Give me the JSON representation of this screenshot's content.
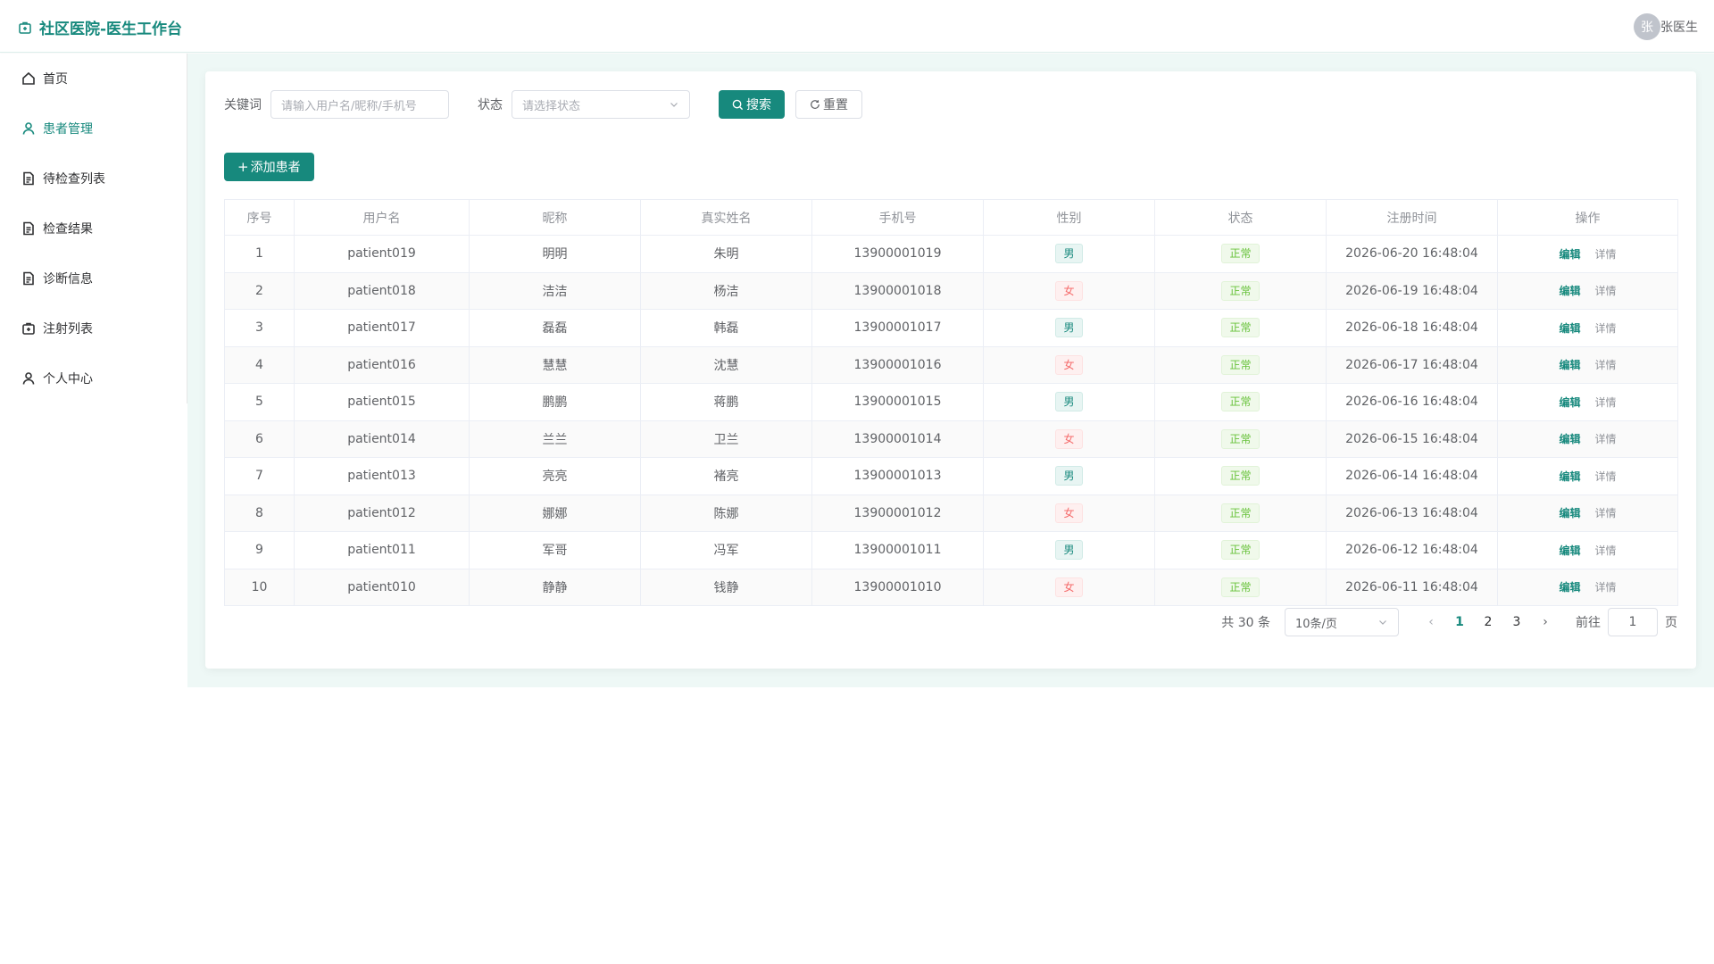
{
  "header": {
    "title": "社区医院-医生工作台",
    "avatar_text": "张",
    "user_name": "张医生"
  },
  "sidebar": {
    "items": [
      {
        "label": "首页",
        "icon": "home-icon"
      },
      {
        "label": "患者管理",
        "icon": "user-icon",
        "active": true
      },
      {
        "label": "待检查列表",
        "icon": "document-icon"
      },
      {
        "label": "检查结果",
        "icon": "document-icon"
      },
      {
        "label": "诊断信息",
        "icon": "document-icon"
      },
      {
        "label": "注射列表",
        "icon": "first-aid-icon"
      },
      {
        "label": "个人中心",
        "icon": "user-icon"
      }
    ]
  },
  "filter": {
    "keyword_label": "关键词",
    "keyword_placeholder": "请输入用户名/昵称/手机号",
    "status_label": "状态",
    "status_placeholder": "请选择状态",
    "search_label": "搜索",
    "reset_label": "重置"
  },
  "add_button_label": "添加患者",
  "table": {
    "columns": [
      "序号",
      "用户名",
      "昵称",
      "真实姓名",
      "手机号",
      "性别",
      "状态",
      "注册时间",
      "操作"
    ],
    "edit_label": "编辑",
    "detail_label": "详情",
    "rows": [
      {
        "no": "1",
        "username": "patient019",
        "nickname": "明明",
        "realname": "朱明",
        "phone": "13900001019",
        "gender": "男",
        "status": "正常",
        "time": "2026-06-20 16:48:04"
      },
      {
        "no": "2",
        "username": "patient018",
        "nickname": "洁洁",
        "realname": "杨洁",
        "phone": "13900001018",
        "gender": "女",
        "status": "正常",
        "time": "2026-06-19 16:48:04"
      },
      {
        "no": "3",
        "username": "patient017",
        "nickname": "磊磊",
        "realname": "韩磊",
        "phone": "13900001017",
        "gender": "男",
        "status": "正常",
        "time": "2026-06-18 16:48:04"
      },
      {
        "no": "4",
        "username": "patient016",
        "nickname": "慧慧",
        "realname": "沈慧",
        "phone": "13900001016",
        "gender": "女",
        "status": "正常",
        "time": "2026-06-17 16:48:04"
      },
      {
        "no": "5",
        "username": "patient015",
        "nickname": "鹏鹏",
        "realname": "蒋鹏",
        "phone": "13900001015",
        "gender": "男",
        "status": "正常",
        "time": "2026-06-16 16:48:04"
      },
      {
        "no": "6",
        "username": "patient014",
        "nickname": "兰兰",
        "realname": "卫兰",
        "phone": "13900001014",
        "gender": "女",
        "status": "正常",
        "time": "2026-06-15 16:48:04"
      },
      {
        "no": "7",
        "username": "patient013",
        "nickname": "亮亮",
        "realname": "褚亮",
        "phone": "13900001013",
        "gender": "男",
        "status": "正常",
        "time": "2026-06-14 16:48:04"
      },
      {
        "no": "8",
        "username": "patient012",
        "nickname": "娜娜",
        "realname": "陈娜",
        "phone": "13900001012",
        "gender": "女",
        "status": "正常",
        "time": "2026-06-13 16:48:04"
      },
      {
        "no": "9",
        "username": "patient011",
        "nickname": "军哥",
        "realname": "冯军",
        "phone": "13900001011",
        "gender": "男",
        "status": "正常",
        "time": "2026-06-12 16:48:04"
      },
      {
        "no": "10",
        "username": "patient010",
        "nickname": "静静",
        "realname": "钱静",
        "phone": "13900001010",
        "gender": "女",
        "status": "正常",
        "time": "2026-06-11 16:48:04"
      }
    ]
  },
  "pagination": {
    "total_text": "共 30 条",
    "page_size": "10条/页",
    "pages": [
      "1",
      "2",
      "3"
    ],
    "current_page": "1",
    "goto_label": "前往",
    "goto_value": "1",
    "page_suffix": "页"
  },
  "colors": {
    "accent": "#17897d",
    "female": "#f56c6c",
    "status_ok": "#67c23a"
  }
}
